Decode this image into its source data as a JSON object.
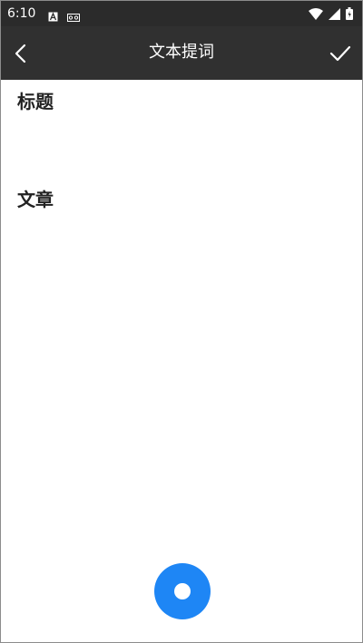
{
  "status_bar": {
    "time": "6:10",
    "left_icons": [
      "notification-a-icon",
      "voicemail-icon"
    ],
    "right_icons": [
      "wifi-icon",
      "signal-icon",
      "battery-icon"
    ]
  },
  "app_bar": {
    "title": "文本提词",
    "back_icon": "chevron-left-icon",
    "confirm_icon": "check-icon"
  },
  "form": {
    "title_label": "标题",
    "title_value": "",
    "article_label": "文章",
    "article_value": ""
  },
  "fab": {
    "icon": "record-icon",
    "color": "#1e86f5"
  },
  "colors": {
    "status_bar_bg": "#2b2b2b",
    "app_bar_bg": "#303030",
    "accent": "#1e86f5"
  }
}
